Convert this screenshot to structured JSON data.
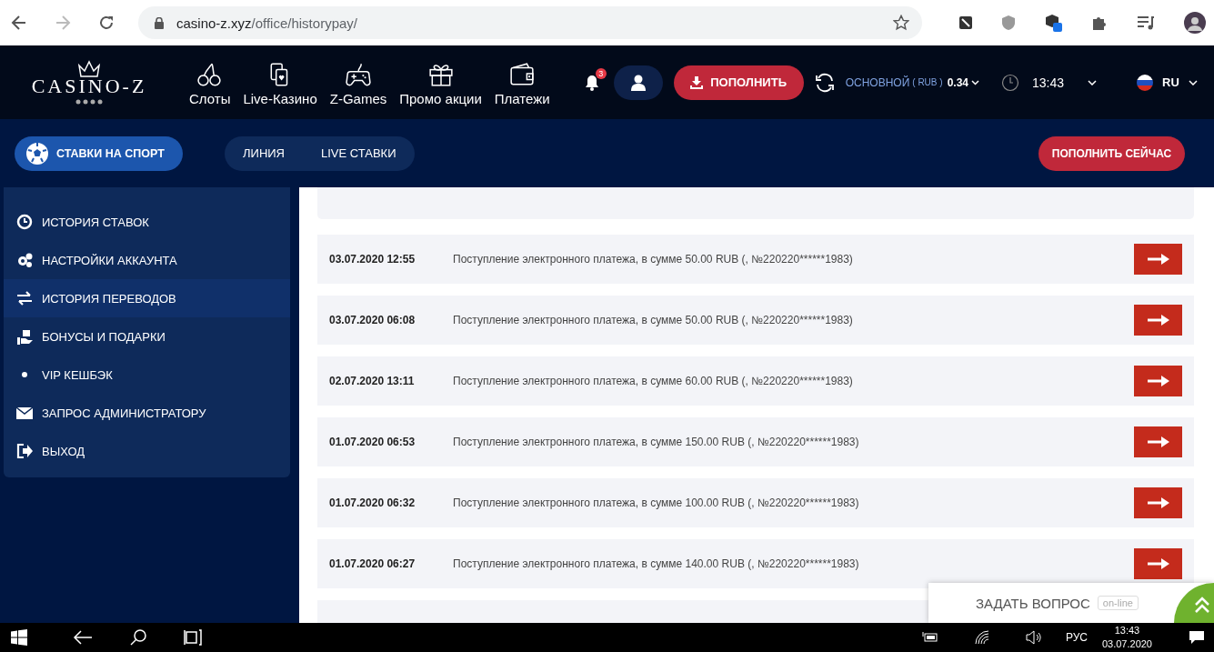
{
  "browser": {
    "url_host": "casino-z.xyz",
    "url_path": "/office/historypay/"
  },
  "header": {
    "logo": "CASINO-Z",
    "nav": [
      {
        "label": "Слоты"
      },
      {
        "label": "Live-Казино"
      },
      {
        "label": "Z-Games"
      },
      {
        "label": "Промо акции"
      },
      {
        "label": "Платежи"
      }
    ],
    "notification_count": "3",
    "deposit_button": "ПОПОЛНИТЬ",
    "balance": {
      "account": "ОСНОВНОЙ",
      "currency": "( RUB )",
      "amount": "0.34"
    },
    "time": "13:43",
    "language": "RU"
  },
  "subnav": {
    "sport_button": "СТАВКИ НА СПОРТ",
    "tabs": [
      {
        "label": "ЛИНИЯ"
      },
      {
        "label": "LIVE СТАВКИ"
      }
    ],
    "deposit_now_button": "ПОПОЛНИТЬ СЕЙЧАС"
  },
  "sidebar": {
    "items": [
      {
        "label": "ИСТОРИЯ СТАВОК",
        "selected": false
      },
      {
        "label": "НАСТРОЙКИ АККАУНТА",
        "selected": false
      },
      {
        "label": "ИСТОРИЯ ПЕРЕВОДОВ",
        "selected": true
      },
      {
        "label": "БОНУСЫ И ПОДАРКИ",
        "selected": false
      },
      {
        "label": "VIP КЕШБЭК",
        "selected": false
      },
      {
        "label": "ЗАПРОС АДМИНИСТРАТОРУ",
        "selected": false
      },
      {
        "label": "ВЫХОД",
        "selected": false
      }
    ]
  },
  "transactions": [
    {
      "date": "03.07.2020 12:55",
      "description": "Поступление электронного платежа, в сумме 50.00 RUB (, №220220******1983)"
    },
    {
      "date": "03.07.2020 06:08",
      "description": "Поступление электронного платежа, в сумме 50.00 RUB (, №220220******1983)"
    },
    {
      "date": "02.07.2020 13:11",
      "description": "Поступление электронного платежа, в сумме 60.00 RUB (, №220220******1983)"
    },
    {
      "date": "01.07.2020 06:53",
      "description": "Поступление электронного платежа, в сумме 150.00 RUB (, №220220******1983)"
    },
    {
      "date": "01.07.2020 06:32",
      "description": "Поступление электронного платежа, в сумме 100.00 RUB (, №220220******1983)"
    },
    {
      "date": "01.07.2020 06:27",
      "description": "Поступление электронного платежа, в сумме 140.00 RUB (, №220220******1983)"
    }
  ],
  "chat": {
    "label": "ЗАДАТЬ ВОПРОС",
    "status": "on-line"
  },
  "taskbar": {
    "language": "РУС",
    "time": "13:43",
    "date": "03.07.2020"
  }
}
